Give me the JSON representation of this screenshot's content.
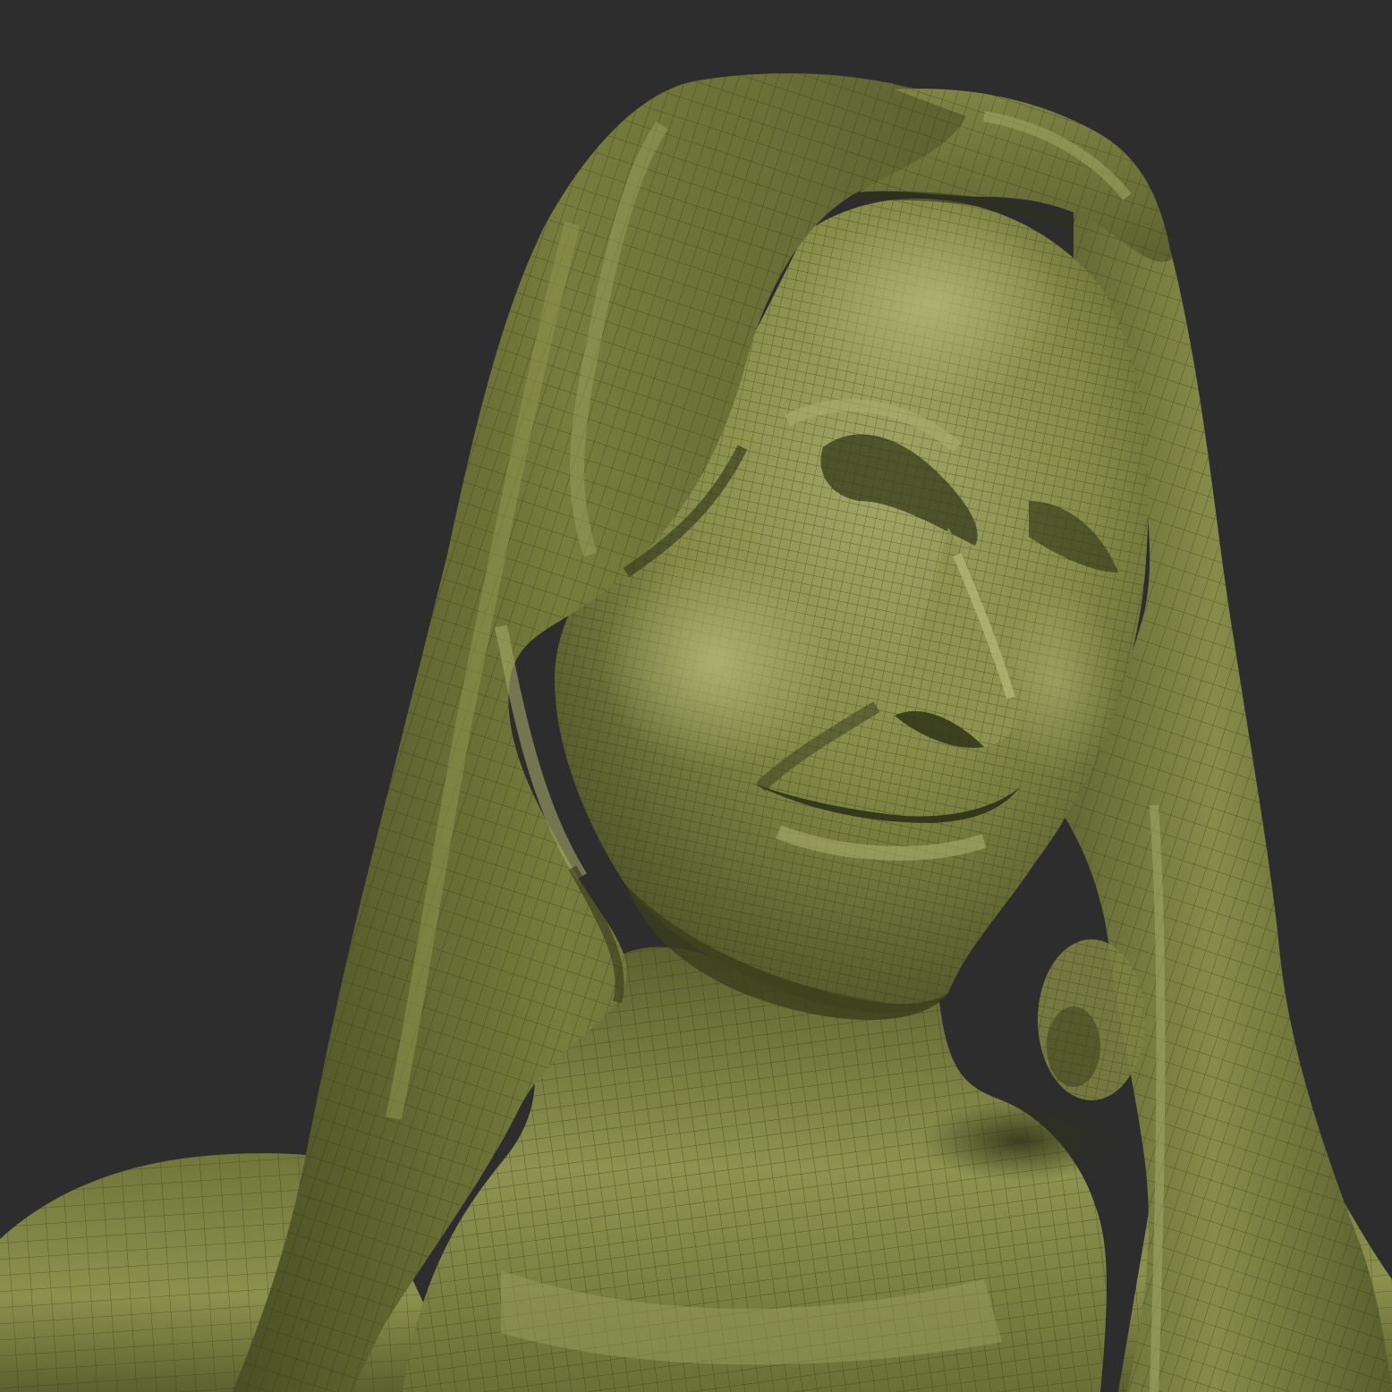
{
  "scene": {
    "background_color": "#2d2d2d",
    "subject": "sculpt-mesh-bust",
    "material_colors": {
      "base": "#6e7438",
      "highlight": "#a3a766",
      "mid": "#80853f",
      "shadow": "#3f4420",
      "deep_shadow": "#2e3217",
      "wire": "#2a2d14"
    },
    "wireframe_visible": true,
    "shading": "matcap"
  }
}
